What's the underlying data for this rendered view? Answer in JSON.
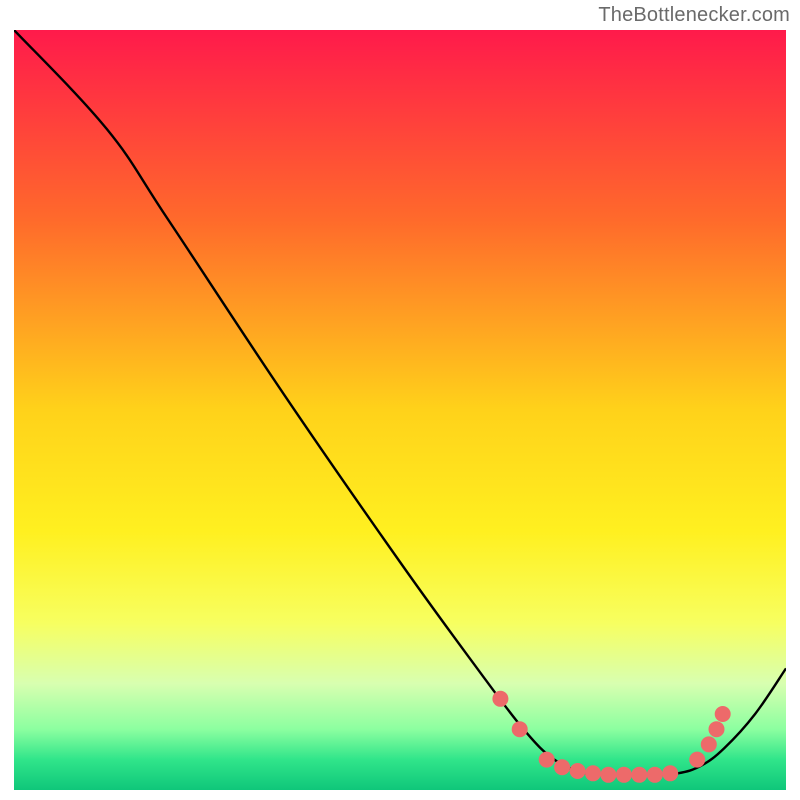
{
  "attribution": "TheBottlenecker.com",
  "chart_data": {
    "type": "line",
    "title": "",
    "xlabel": "",
    "ylabel": "",
    "xlim": [
      0,
      100
    ],
    "ylim": [
      0,
      100
    ],
    "grid": false,
    "legend": false,
    "annotations": [],
    "background_gradient_stops": [
      {
        "offset": 0.0,
        "color": "#ff1a4b"
      },
      {
        "offset": 0.25,
        "color": "#ff6a2b"
      },
      {
        "offset": 0.5,
        "color": "#ffd21a"
      },
      {
        "offset": 0.66,
        "color": "#fff020"
      },
      {
        "offset": 0.78,
        "color": "#f7ff60"
      },
      {
        "offset": 0.86,
        "color": "#d8ffb0"
      },
      {
        "offset": 0.92,
        "color": "#8cffa0"
      },
      {
        "offset": 0.96,
        "color": "#30e58a"
      },
      {
        "offset": 1.0,
        "color": "#0fc77a"
      }
    ],
    "series": [
      {
        "name": "curve",
        "color": "#000000",
        "points": [
          {
            "x": 0,
            "y": 100
          },
          {
            "x": 12,
            "y": 87
          },
          {
            "x": 20,
            "y": 75
          },
          {
            "x": 35,
            "y": 52
          },
          {
            "x": 50,
            "y": 30
          },
          {
            "x": 60,
            "y": 16
          },
          {
            "x": 66,
            "y": 8
          },
          {
            "x": 70,
            "y": 4
          },
          {
            "x": 74,
            "y": 2.2
          },
          {
            "x": 78,
            "y": 2.0
          },
          {
            "x": 82,
            "y": 2.0
          },
          {
            "x": 86,
            "y": 2.2
          },
          {
            "x": 89,
            "y": 3.2
          },
          {
            "x": 92,
            "y": 5.5
          },
          {
            "x": 96,
            "y": 10
          },
          {
            "x": 100,
            "y": 16
          }
        ]
      }
    ],
    "markers": {
      "color": "#ed6a6a",
      "radius_px": 8,
      "points": [
        {
          "x": 63.0,
          "y": 12.0
        },
        {
          "x": 65.5,
          "y": 8.0
        },
        {
          "x": 69.0,
          "y": 4.0
        },
        {
          "x": 71.0,
          "y": 3.0
        },
        {
          "x": 73.0,
          "y": 2.5
        },
        {
          "x": 75.0,
          "y": 2.2
        },
        {
          "x": 77.0,
          "y": 2.0
        },
        {
          "x": 79.0,
          "y": 2.0
        },
        {
          "x": 81.0,
          "y": 2.0
        },
        {
          "x": 83.0,
          "y": 2.0
        },
        {
          "x": 85.0,
          "y": 2.2
        },
        {
          "x": 88.5,
          "y": 4.0
        },
        {
          "x": 90.0,
          "y": 6.0
        },
        {
          "x": 91.0,
          "y": 8.0
        },
        {
          "x": 91.8,
          "y": 10.0
        }
      ]
    }
  }
}
